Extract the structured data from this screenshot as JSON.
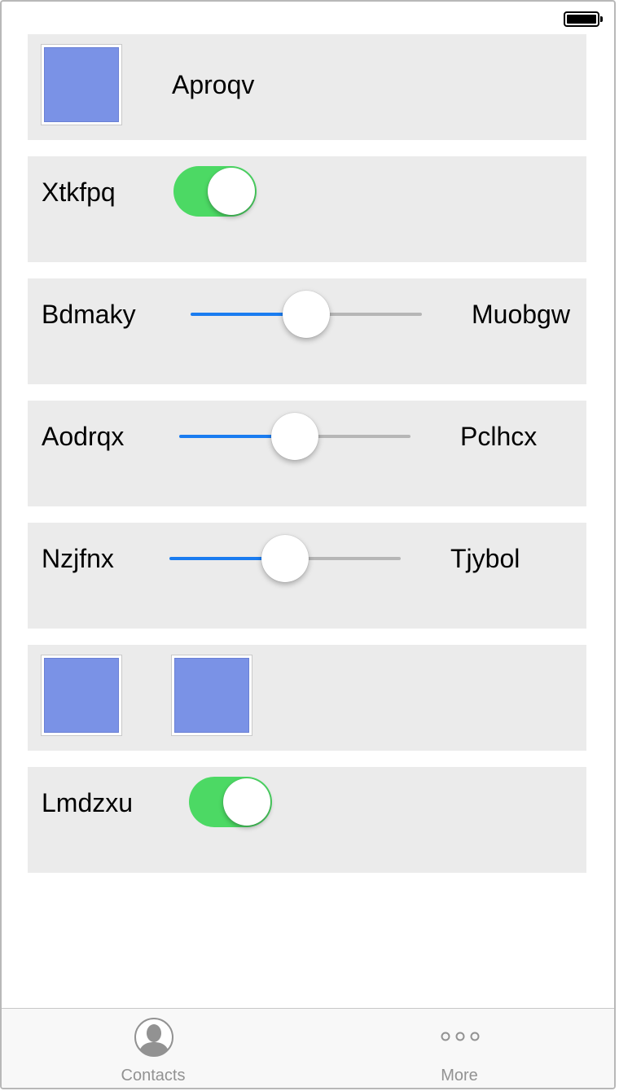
{
  "status_bar": {
    "battery_icon": "battery-full-icon"
  },
  "rows": {
    "image_row": {
      "label": "Aproqv"
    },
    "switch_row_1": {
      "label": "Xtkfpq",
      "on": true
    },
    "slider_row_1": {
      "min_label": "Bdmaky",
      "max_label": "Muobgw",
      "value": 0.5
    },
    "slider_row_2": {
      "min_label": "Aodrqx",
      "max_label": "Pclhcx",
      "value": 0.5
    },
    "slider_row_3": {
      "min_label": "Nzjfnx",
      "max_label": "Tjybol",
      "value": 0.5
    },
    "switch_row_2": {
      "label": "Lmdzxu",
      "on": true
    }
  },
  "tab_bar": {
    "tabs": [
      {
        "label": "Contacts",
        "icon": "contacts-icon"
      },
      {
        "label": "More",
        "icon": "more-icon"
      }
    ]
  },
  "colors": {
    "switch_on": "#4cd964",
    "slider_min_track": "#1a7cf0",
    "slider_max_track": "#b6b6b6",
    "image_fill": "#7a92e6",
    "row_background": "#ebebeb"
  }
}
